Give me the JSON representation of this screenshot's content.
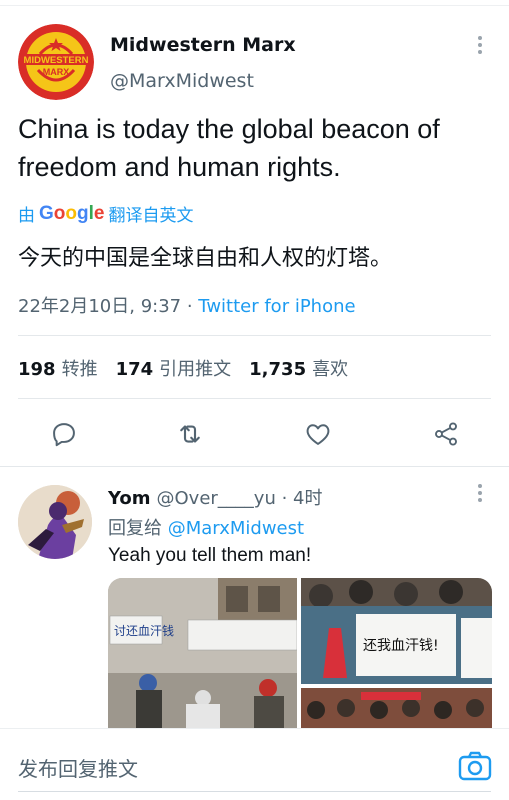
{
  "tweet": {
    "author_name": "Midwestern Marx",
    "author_handle": "@MarxMidwest",
    "logo_text_top": "MIDWESTERN",
    "logo_text_bottom": "MARX",
    "text": "China is today the global beacon of freedom and human rights.",
    "translate_prefix": "由",
    "translate_brand": "Google",
    "translate_suffix": "翻译自英文",
    "translated_text": "今天的中国是全球自由和人权的灯塔。",
    "date": "22年2月10日, 9:37 · ",
    "source": "Twitter for iPhone",
    "stats": [
      {
        "value": "198",
        "label": "转推"
      },
      {
        "value": "174",
        "label": "引用推文"
      },
      {
        "value": "1,735",
        "label": "喜欢"
      }
    ],
    "actions": [
      "reply-icon",
      "retweet-icon",
      "like-icon",
      "share-icon"
    ]
  },
  "reply": {
    "name": "Yom",
    "handle_time": "@Over____yu · 4时",
    "reply_prefix": "回复给 ",
    "reply_mention": "@MarxMidwest",
    "text": "Yeah you tell them man!",
    "photo_sign_1": "讨还血汗钱",
    "photo_sign_2": "还我血汗钱!"
  },
  "compose": {
    "placeholder": "发布回复推文",
    "icon": "camera-icon"
  },
  "colors": {
    "accent": "#1d9bf0",
    "text": "#0f1419",
    "secondary": "#536471",
    "logo_red": "#d92d27",
    "logo_yellow": "#f5c518"
  }
}
